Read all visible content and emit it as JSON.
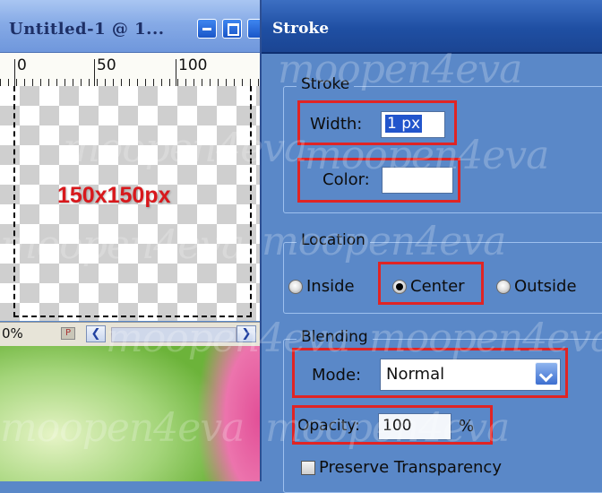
{
  "document_window": {
    "title": "Untitled-1 @ 1...",
    "ruler_labels": [
      "0",
      "50",
      "100"
    ],
    "canvas_label": "150x150px",
    "zoom": "0%"
  },
  "stroke_dialog": {
    "title": "Stroke",
    "stroke_group": {
      "label": "Stroke",
      "width_label": "Width:",
      "width_value": "1 px",
      "color_label": "Color:",
      "color_value": "#ffffff"
    },
    "location_group": {
      "label": "Location",
      "options": [
        "Inside",
        "Center",
        "Outside"
      ],
      "selected": "Center"
    },
    "blending_group": {
      "label": "Blending",
      "mode_label": "Mode:",
      "mode_value": "Normal",
      "opacity_label": "Opacity:",
      "opacity_value": "100",
      "opacity_unit": "%",
      "preserve_label": "Preserve Transparency",
      "preserve_checked": false
    }
  },
  "watermark_text": "moopen4eva",
  "colors": {
    "dialog_bg": "#5a88c8",
    "highlight": "#e02424",
    "canvas_label": "#d8181c"
  }
}
